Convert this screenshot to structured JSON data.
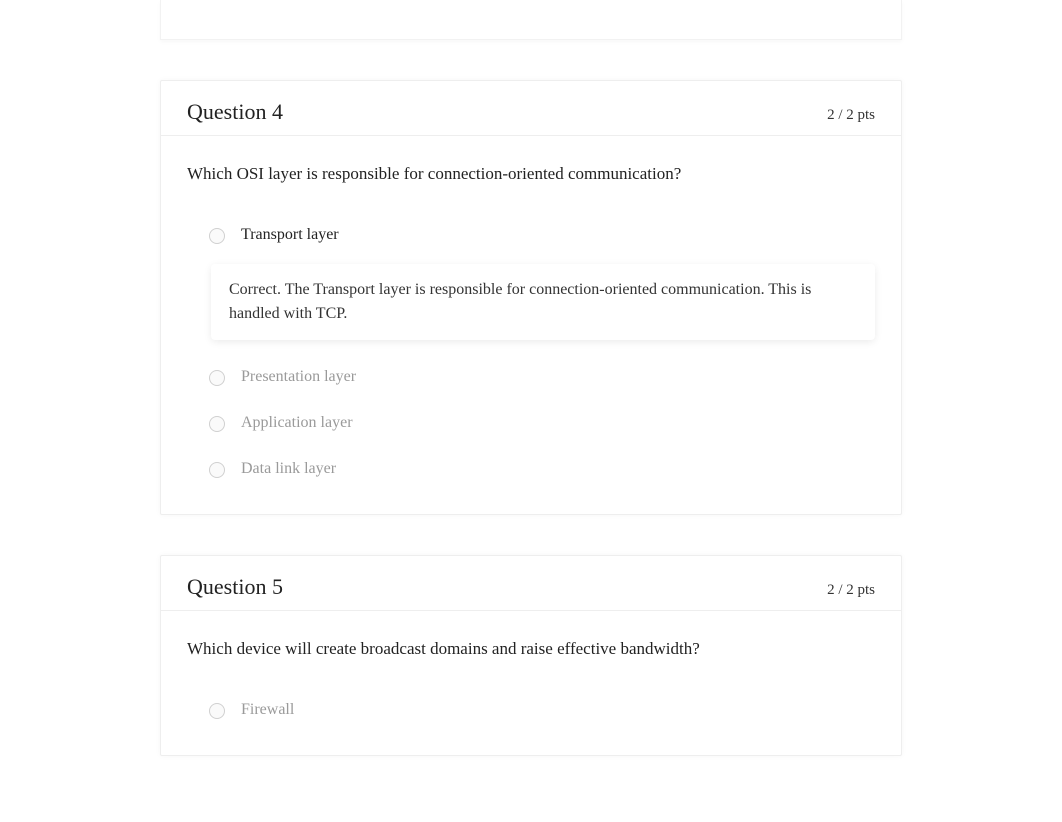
{
  "questions": [
    {
      "title": "Question 4",
      "points": "2 / 2 pts",
      "prompt": "Which OSI layer is responsible for connection-oriented communication?",
      "answers": [
        {
          "text": "Transport layer",
          "selected": true,
          "dim": false
        },
        {
          "text": "Presentation layer",
          "selected": false,
          "dim": true
        },
        {
          "text": "Application layer",
          "selected": false,
          "dim": true
        },
        {
          "text": "Data link layer",
          "selected": false,
          "dim": true
        }
      ],
      "feedback": "Correct. The Transport layer is responsible for connection-oriented communication. This is handled with TCP."
    },
    {
      "title": "Question 5",
      "points": "2 / 2 pts",
      "prompt": "Which device will create broadcast domains and raise effective bandwidth?",
      "answers": [
        {
          "text": "Firewall",
          "selected": false,
          "dim": true
        }
      ],
      "feedback": null
    }
  ]
}
